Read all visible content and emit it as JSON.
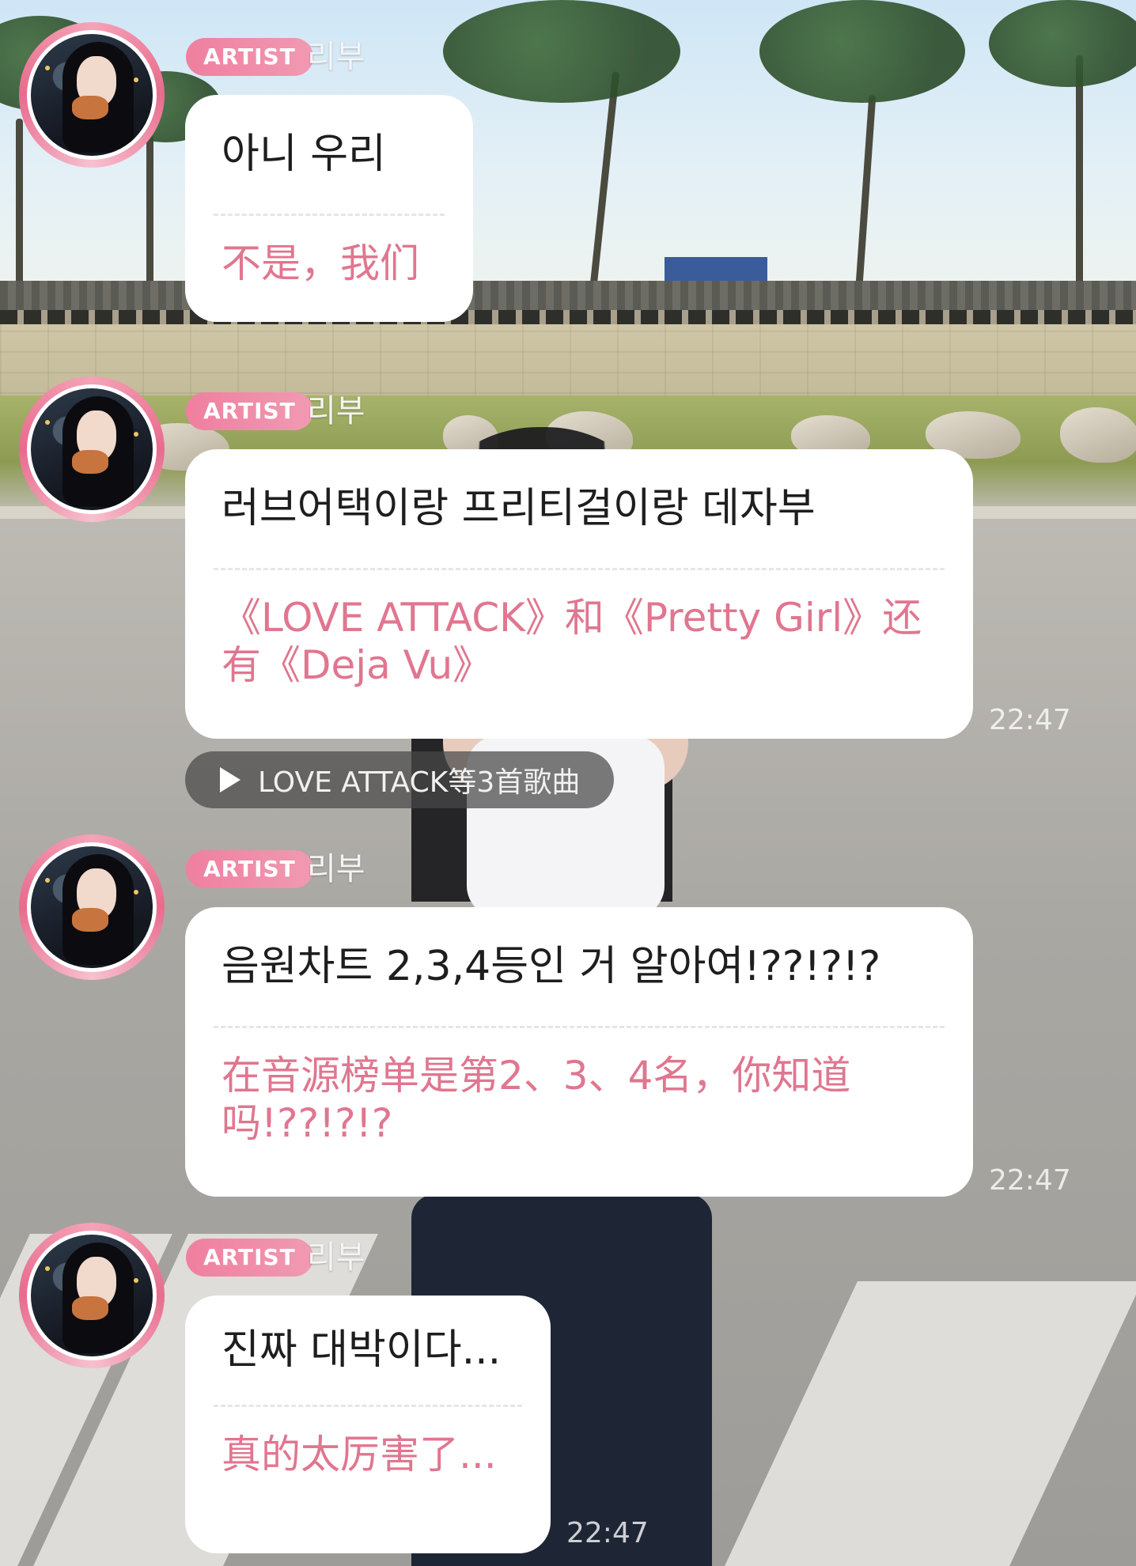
{
  "messages": [
    {
      "badge": "ARTIST",
      "author": "리부",
      "korean": "아니 우리",
      "translation": "不是，我们",
      "time": ""
    },
    {
      "badge": "ARTIST",
      "author": "리부",
      "korean": "러브어택이랑 프리티걸이랑 데자부",
      "translation": "《LOVE ATTACK》和《Pretty Girl》还有《Deja Vu》",
      "time": "22:47"
    },
    {
      "badge": "ARTIST",
      "author": "리부",
      "korean": "음원차트 2,3,4등인 거 알아여!??!?!?",
      "translation": "在音源榜单是第2、3、4名，你知道吗!??!?!?",
      "time": "22:47"
    },
    {
      "badge": "ARTIST",
      "author": "리부",
      "korean": "진짜 대박이다...",
      "translation": "真的太厉害了...",
      "time": "22:47"
    }
  ],
  "song_chip": {
    "label": "LOVE ATTACK等3首歌曲",
    "icon": "play-icon"
  },
  "colors": {
    "badge": "#ef7f9f",
    "translation_text": "#e0768f",
    "bubble": "#ffffff",
    "song_chip_bg": "#484848"
  }
}
